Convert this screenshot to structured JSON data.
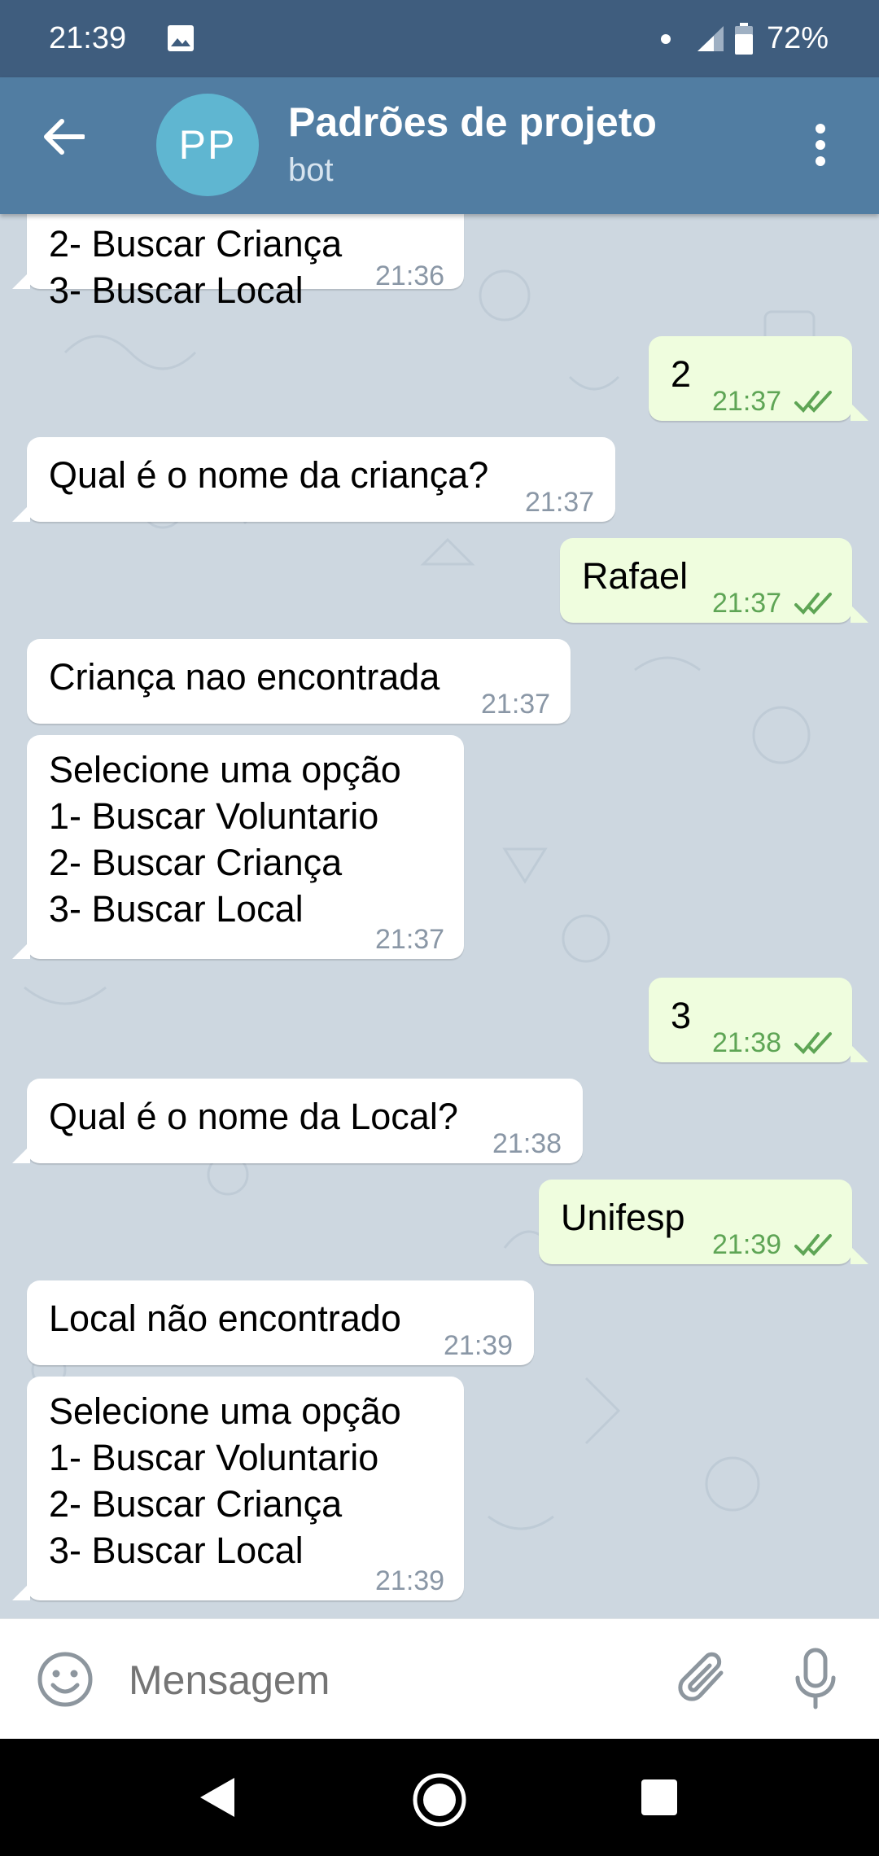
{
  "status_bar": {
    "time": "21:39",
    "battery": "72%"
  },
  "header": {
    "avatar_initials": "PP",
    "title": "Padrões de projeto",
    "subtitle": "bot"
  },
  "messages": [
    {
      "text": "2- Buscar Criança\n3- Buscar Local",
      "time": "21:36"
    },
    {
      "text": "2",
      "time": "21:37"
    },
    {
      "text": "Qual é o nome da criança?",
      "time": "21:37"
    },
    {
      "text": "Rafael",
      "time": "21:37"
    },
    {
      "text": "Criança nao encontrada",
      "time": "21:37"
    },
    {
      "text": "Selecione uma opção\n1- Buscar Voluntario\n2- Buscar Criança\n3- Buscar Local",
      "time": "21:37"
    },
    {
      "text": "3",
      "time": "21:38"
    },
    {
      "text": "Qual é o nome da Local?",
      "time": "21:38"
    },
    {
      "text": "Unifesp",
      "time": "21:39"
    },
    {
      "text": "Local não encontrado",
      "time": "21:39"
    },
    {
      "text": "Selecione uma opção\n1- Buscar Voluntario\n2- Buscar Criança\n3- Buscar Local",
      "time": "21:39"
    }
  ],
  "input": {
    "placeholder": "Mensagem"
  },
  "colors": {
    "status_bar": "#3f5d7e",
    "header": "#517da2",
    "incoming": "#ffffff",
    "outgoing": "#effdde",
    "read_check": "#5ea555"
  }
}
